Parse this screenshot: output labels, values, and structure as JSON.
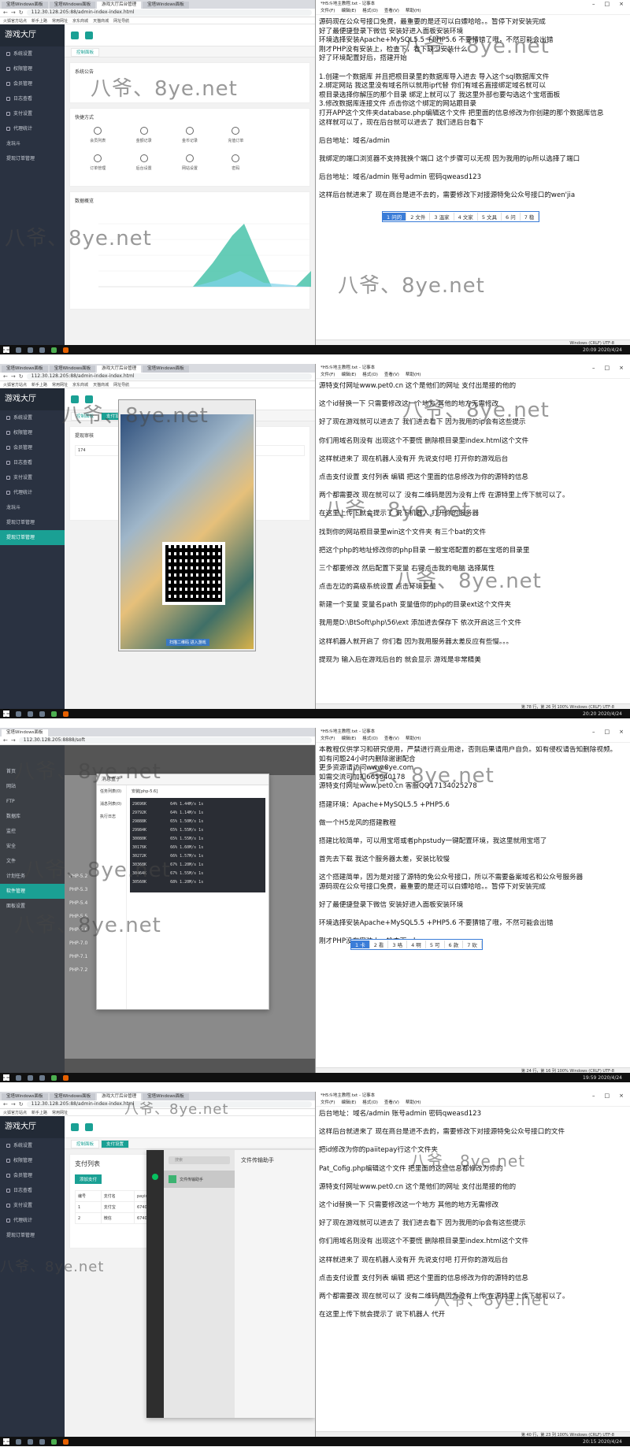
{
  "screens": [
    {
      "browser": {
        "tabs": [
          "宝塔Windows面板",
          "宝塔Windows面板",
          "游戏大厅后台管理",
          "宝塔Windows面板"
        ],
        "url": "112.30.128.205:88/admin-index-index.html",
        "bookmarks": [
          "火狐官方站点",
          "新手上路",
          "常用网址",
          "京东商城",
          "天猫商城",
          "网址导航"
        ]
      },
      "admin": {
        "brand": "游戏大厅",
        "menu": [
          "系统设置",
          "权限管理",
          "会员管理",
          "日志查看",
          "支付设置",
          "代理统计",
          "龙玩斗",
          "提现订单管理"
        ],
        "tabs": [
          "控制面板"
        ],
        "announcement_title": "系统公告",
        "shortcuts_title": "快捷方式",
        "shortcuts": [
          "会员列表",
          "金额记录",
          "金币记录",
          "充值订单",
          "订单管理",
          "后台设置",
          "网站设置",
          "密码"
        ],
        "chart_title": "数据概览",
        "footer": "本系统仅作为学习参考使用"
      },
      "notepad": {
        "title": "*H5斗地主教程.txt - 记事本",
        "menu": [
          "文件(F)",
          "编辑(E)",
          "格式(O)",
          "查看(V)",
          "帮助(H)"
        ],
        "lines": [
          "源码现在公众号接口免费，最重要的是还可以白嫖哈哈。。暂停下对安装完成",
          "好了最便捷登录下微信 安装好进入面板安装环境",
          "环境选择安装Apache+MySQL5.5 +PHP5.6 不要猜错了哦，不然可能会出错",
          "刚才PHP没有安装上，检查下，看下缺少安装什么",
          "好了环境配置好后，搭建开始",
          "",
          "1.创建一个数据库  并且把根目录里的数据库导入进去 导入这个sql数据库文件",
          "2.绑定网站 我这里没有域名所以就用ip代替 你们有域名直接绑定域名就可以",
          "根目录选择你解压的那个目录 绑定上就可以了 我这里外部也要勾选这个宝塔面板",
          "3.修改数据库连接文件 点击你这个绑定的网站跟目录",
          "打开APP这个文件夹database.php编辑这个文件 把里面的信息修改为你创建的那个数据库信息",
          "这样就可以了，现在后台就可以进去了 我们进后台看下",
          "",
          "后台地址：域名/admin",
          "",
          "我绑定的端口浏览器不支持我换个端口 这个步骤可以无视 因为我用的ip所以选择了端口",
          "",
          "后台地址：域名/admin   账号admin 密码qweasd123",
          "",
          "这样后台就进来了  现在商台是进不去的，需要修改下对接源特免公众号接口的wen'jia"
        ],
        "ime": [
          "1 问的",
          "2 文件",
          "3 温家",
          "4 文家",
          "5 文具",
          "6 问",
          "7 稳"
        ],
        "status": "Windows (CRLF)    UTF-8"
      },
      "clock": "20:09 2020/4/24"
    },
    {
      "browser": {
        "tabs": [
          "宝塔Windows面板",
          "宝塔Windows面板",
          "游戏大厅后台管理",
          "宝塔Windows面板"
        ],
        "url": "112.30.128.205:88/admin-index-index.html",
        "bookmarks": [
          "火狐官方站点",
          "新手上路",
          "常用网址",
          "京东商城",
          "天猫商城",
          "网址导航"
        ]
      },
      "admin": {
        "tabs": [
          "控制面板",
          "支付设置"
        ],
        "panel_title": "提现审核",
        "table_cells": [
          "174",
          "09522",
          "2020-0"
        ],
        "qr_caption": "扫描二维码 进入游戏"
      },
      "notepad": {
        "lines": [
          "源特支付网址www.pet0.cn  这个是他们的网址 支付出是接的他的",
          "这个id替换一下 只需要修改这一个地方 其他的地方无需修改",
          "好了现在游戏就可以进去了 我们进去看下  因为我用的ip会有这些提示",
          "你们用域名则没有  出现这个不要慌 删除根目录里index.html这个文件",
          "这样就进来了  现在机器人没有开 先说支付吧 打开你的游戏后台",
          "点击支付设置 支付列表 编辑 把这个里面的信息修改为你的源特的信息",
          "两个都需要改 现在就可以了 没有二维码是因为没有上传 在源特里上传下就可以了。",
          "在这里上传下就会提示了  说下机器人 打开你的服务器",
          "找到你的网站根目录里win这个文件夹 有三个bat的文件",
          "把这个php的地址修改你的php目录 一般宝塔配置的都在宝塔的目录里",
          "三个都要修改 然后配置下变量 右键点击我的电脑 选择属性",
          "点击左边的高级系统设置 点击环境变量",
          "新建一个变量 变量名path  变量值你的php的目录ext这个文件夹",
          "我用是D:\\BtSoft\\php\\56\\ext 添加进去保存下 依次开启这三个文件",
          "这样机器人就开启了 你们看 因为我用服务器太差反应有些慢。。。",
          "提现为 输入后在游戏后台的  就会显示  游戏是非常精美"
        ],
        "status": "第 78 行，第 26 列    100%   Windows (CRLF)    UTF-8"
      },
      "clock": "20:20 2020/4/24"
    },
    {
      "bt": {
        "title": "宝塔Windows面板",
        "url": "112.30.128.205:8888/soft",
        "menu": [
          "首页",
          "网站",
          "FTP",
          "数据库",
          "监控",
          "安全",
          "文件",
          "计划任务",
          "软件管理",
          "面板设置"
        ],
        "dialog_title": "消息盒子",
        "dialog_side": [
          "任务列表(0)",
          "消息列表(0)",
          "执行日志"
        ],
        "dialog_item": "安装[php-5.6]",
        "rows": [
          "29696K",
          "29792K",
          "29888K",
          "29984K",
          "30080K",
          "30176K",
          "30272K",
          "30368K",
          "30464K",
          "30560K"
        ],
        "rows_right": [
          "64% 1.44M/s 1s",
          "64% 1.14M/s 1s",
          "65% 1.50M/s 1s",
          "65% 1.55M/s 1s",
          "65% 1.55M/s 1s",
          "66% 1.60M/s 1s",
          "66% 1.57M/s 1s",
          "67% 1.20M/s 1s",
          "67% 1.55M/s 1s",
          "68% 1.20M/s 1s"
        ],
        "soft": [
          "PHP-5.2",
          "PHP-5.3",
          "PHP-5.4",
          "PHP-5.5",
          "PHP-5.6",
          "PHP-7.0",
          "PHP-7.1",
          "PHP-7.2"
        ]
      },
      "notepad": {
        "lines": [
          "本教程仅供学习和研究使用，严禁进行商业用途，否则后果请用户自负。如有侵权请告知删除视频。",
          "如有问题24小时内删除谢谢配合",
          "更多资源请访问www.8ye.com",
          "如需交流可加扣665640178",
          "源特支付网址www.pet0.cn  客服QQ17134025278",
          "",
          "搭建环境：Apache+MySQL5.5 +PHP5.6",
          "",
          "做一个H5龙风的搭建教程",
          "",
          "搭建比较简单，可以用宝塔或者phpstudy一键配置环境，我这里就用宝塔了",
          "",
          "首先去下载 我这个服务器太差，安装比较慢",
          "",
          "这个搭建简单，因为是对接了源特的免公众号接口，所以不需要备案域名和公众号服务器",
          "源码现在公众号接口免费，最重要的是还可以白嫖哈哈。。暂停下对安装完成",
          "",
          "好了最便捷登录下微信 安装好进入面板安装环境",
          "",
          "环境选择安装Apache+MySQL5.5 +PHP5.6 不要猜错了哦，不然可能会出错",
          "",
          "刚才PHP没有安装上，检查下，k"
        ],
        "ime": [
          "1 卡",
          "2 看",
          "3 咯",
          "4 啊",
          "5 可",
          "6 款",
          "7 砍"
        ],
        "status": "第 24 行，第 16 列    100%   Windows (CRLF)    UTF-8"
      },
      "clock": "19:59 2020/4/24"
    },
    {
      "admin": {
        "tabs": [
          "控制面板",
          "支付设置"
        ],
        "panel_title": "支付列表",
        "add_button": "添加支付",
        "columns": [
          "编号",
          "支付名",
          "payid"
        ],
        "rows": [
          [
            "1",
            "支付宝",
            "67400"
          ],
          [
            "2",
            "微信",
            "67400"
          ]
        ],
        "file_window_title": "文件传输助手",
        "file_name": "文件传输助手",
        "search_placeholder": "搜索"
      },
      "notepad": {
        "lines": [
          "后台地址：域名/admin   账号admin 密码qweasd123",
          "",
          "这样后台就进来了  现在商台是进不去的，需要修改下对接源特免公众号接口的文件",
          "",
          "把id修改为你的paiitepay行这个文件夹",
          "",
          "Pat_Cofig.php编辑这个文件  把里面的这些信息都修改为你的",
          "",
          "源特支付网址www.pet0.cn  这个是他们的网址 支付出是接的他的",
          "",
          "这个id替换一下 只需要修改这一个地方 其他的地方无需修改",
          "",
          "好了现在游戏就可以进去了 我们进去看下  因为我用的ip会有这些提示",
          "",
          "你们用域名则没有  出现这个不要慌 删除根目录里index.html这个文件",
          "",
          "这样就进来了  现在机器人没有开 先说支付吧 打开你的游戏后台",
          "",
          "点击支付设置 支付列表 编辑 把这个里面的信息修改为你的源特的信息",
          "",
          "两个都需要改 现在就可以了 没有二维码是因为没有上传 在源特里上传下就可以了。",
          "",
          "在这里上传下就会提示了  说下机器人  代开"
        ],
        "status": "第 40 行，第 23 列    100%   Windows (CRLF)    UTF-8"
      },
      "clock": "20:15 2020/4/24"
    }
  ],
  "watermark": "八爷、8ye.net"
}
